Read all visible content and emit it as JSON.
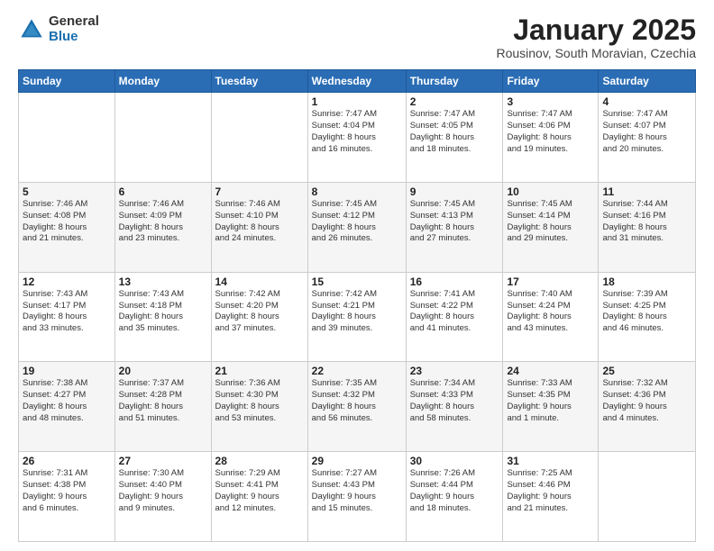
{
  "logo": {
    "general": "General",
    "blue": "Blue"
  },
  "header": {
    "title": "January 2025",
    "location": "Rousinov, South Moravian, Czechia"
  },
  "weekdays": [
    "Sunday",
    "Monday",
    "Tuesday",
    "Wednesday",
    "Thursday",
    "Friday",
    "Saturday"
  ],
  "weeks": [
    [
      {
        "day": "",
        "info": ""
      },
      {
        "day": "",
        "info": ""
      },
      {
        "day": "",
        "info": ""
      },
      {
        "day": "1",
        "info": "Sunrise: 7:47 AM\nSunset: 4:04 PM\nDaylight: 8 hours\nand 16 minutes."
      },
      {
        "day": "2",
        "info": "Sunrise: 7:47 AM\nSunset: 4:05 PM\nDaylight: 8 hours\nand 18 minutes."
      },
      {
        "day": "3",
        "info": "Sunrise: 7:47 AM\nSunset: 4:06 PM\nDaylight: 8 hours\nand 19 minutes."
      },
      {
        "day": "4",
        "info": "Sunrise: 7:47 AM\nSunset: 4:07 PM\nDaylight: 8 hours\nand 20 minutes."
      }
    ],
    [
      {
        "day": "5",
        "info": "Sunrise: 7:46 AM\nSunset: 4:08 PM\nDaylight: 8 hours\nand 21 minutes."
      },
      {
        "day": "6",
        "info": "Sunrise: 7:46 AM\nSunset: 4:09 PM\nDaylight: 8 hours\nand 23 minutes."
      },
      {
        "day": "7",
        "info": "Sunrise: 7:46 AM\nSunset: 4:10 PM\nDaylight: 8 hours\nand 24 minutes."
      },
      {
        "day": "8",
        "info": "Sunrise: 7:45 AM\nSunset: 4:12 PM\nDaylight: 8 hours\nand 26 minutes."
      },
      {
        "day": "9",
        "info": "Sunrise: 7:45 AM\nSunset: 4:13 PM\nDaylight: 8 hours\nand 27 minutes."
      },
      {
        "day": "10",
        "info": "Sunrise: 7:45 AM\nSunset: 4:14 PM\nDaylight: 8 hours\nand 29 minutes."
      },
      {
        "day": "11",
        "info": "Sunrise: 7:44 AM\nSunset: 4:16 PM\nDaylight: 8 hours\nand 31 minutes."
      }
    ],
    [
      {
        "day": "12",
        "info": "Sunrise: 7:43 AM\nSunset: 4:17 PM\nDaylight: 8 hours\nand 33 minutes."
      },
      {
        "day": "13",
        "info": "Sunrise: 7:43 AM\nSunset: 4:18 PM\nDaylight: 8 hours\nand 35 minutes."
      },
      {
        "day": "14",
        "info": "Sunrise: 7:42 AM\nSunset: 4:20 PM\nDaylight: 8 hours\nand 37 minutes."
      },
      {
        "day": "15",
        "info": "Sunrise: 7:42 AM\nSunset: 4:21 PM\nDaylight: 8 hours\nand 39 minutes."
      },
      {
        "day": "16",
        "info": "Sunrise: 7:41 AM\nSunset: 4:22 PM\nDaylight: 8 hours\nand 41 minutes."
      },
      {
        "day": "17",
        "info": "Sunrise: 7:40 AM\nSunset: 4:24 PM\nDaylight: 8 hours\nand 43 minutes."
      },
      {
        "day": "18",
        "info": "Sunrise: 7:39 AM\nSunset: 4:25 PM\nDaylight: 8 hours\nand 46 minutes."
      }
    ],
    [
      {
        "day": "19",
        "info": "Sunrise: 7:38 AM\nSunset: 4:27 PM\nDaylight: 8 hours\nand 48 minutes."
      },
      {
        "day": "20",
        "info": "Sunrise: 7:37 AM\nSunset: 4:28 PM\nDaylight: 8 hours\nand 51 minutes."
      },
      {
        "day": "21",
        "info": "Sunrise: 7:36 AM\nSunset: 4:30 PM\nDaylight: 8 hours\nand 53 minutes."
      },
      {
        "day": "22",
        "info": "Sunrise: 7:35 AM\nSunset: 4:32 PM\nDaylight: 8 hours\nand 56 minutes."
      },
      {
        "day": "23",
        "info": "Sunrise: 7:34 AM\nSunset: 4:33 PM\nDaylight: 8 hours\nand 58 minutes."
      },
      {
        "day": "24",
        "info": "Sunrise: 7:33 AM\nSunset: 4:35 PM\nDaylight: 9 hours\nand 1 minute."
      },
      {
        "day": "25",
        "info": "Sunrise: 7:32 AM\nSunset: 4:36 PM\nDaylight: 9 hours\nand 4 minutes."
      }
    ],
    [
      {
        "day": "26",
        "info": "Sunrise: 7:31 AM\nSunset: 4:38 PM\nDaylight: 9 hours\nand 6 minutes."
      },
      {
        "day": "27",
        "info": "Sunrise: 7:30 AM\nSunset: 4:40 PM\nDaylight: 9 hours\nand 9 minutes."
      },
      {
        "day": "28",
        "info": "Sunrise: 7:29 AM\nSunset: 4:41 PM\nDaylight: 9 hours\nand 12 minutes."
      },
      {
        "day": "29",
        "info": "Sunrise: 7:27 AM\nSunset: 4:43 PM\nDaylight: 9 hours\nand 15 minutes."
      },
      {
        "day": "30",
        "info": "Sunrise: 7:26 AM\nSunset: 4:44 PM\nDaylight: 9 hours\nand 18 minutes."
      },
      {
        "day": "31",
        "info": "Sunrise: 7:25 AM\nSunset: 4:46 PM\nDaylight: 9 hours\nand 21 minutes."
      },
      {
        "day": "",
        "info": ""
      }
    ]
  ]
}
